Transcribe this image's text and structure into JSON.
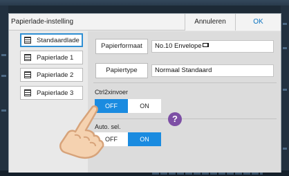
{
  "dialog": {
    "title": "Papierlade-instelling",
    "cancel_label": "Annuleren",
    "ok_label": "OK"
  },
  "trays": [
    {
      "label": "Standaardlade",
      "selected": true,
      "icon": "paper-tray-icon"
    },
    {
      "label": "Papierlade 1",
      "selected": false,
      "icon": "paper-tray-icon"
    },
    {
      "label": "Papierlade 2",
      "selected": false,
      "icon": "paper-tray-icon"
    },
    {
      "label": "Papierlade 3",
      "selected": false,
      "icon": "paper-tray-icon"
    }
  ],
  "settings": {
    "paper_size": {
      "button_label": "Papierformaat",
      "value": "No.10 Envelope",
      "value_icon": "landscape-envelope-icon"
    },
    "paper_type": {
      "button_label": "Papiertype",
      "value": "Normaal Standaard"
    },
    "ctrl2x": {
      "label": "Ctrl2xinvoer",
      "off_label": "OFF",
      "on_label": "ON",
      "selected": "OFF",
      "help_icon": "question-mark-icon"
    },
    "auto_sel": {
      "label": "Auto. sel.",
      "off_label": "OFF",
      "on_label": "ON",
      "selected": "ON"
    }
  },
  "colors": {
    "accent": "#1a8be0",
    "ok_text": "#0a73c1",
    "help": "#7d4fa5",
    "hand_fill": "#f5d2b0"
  },
  "overlay": {
    "icon": "pointing-hand-icon"
  }
}
